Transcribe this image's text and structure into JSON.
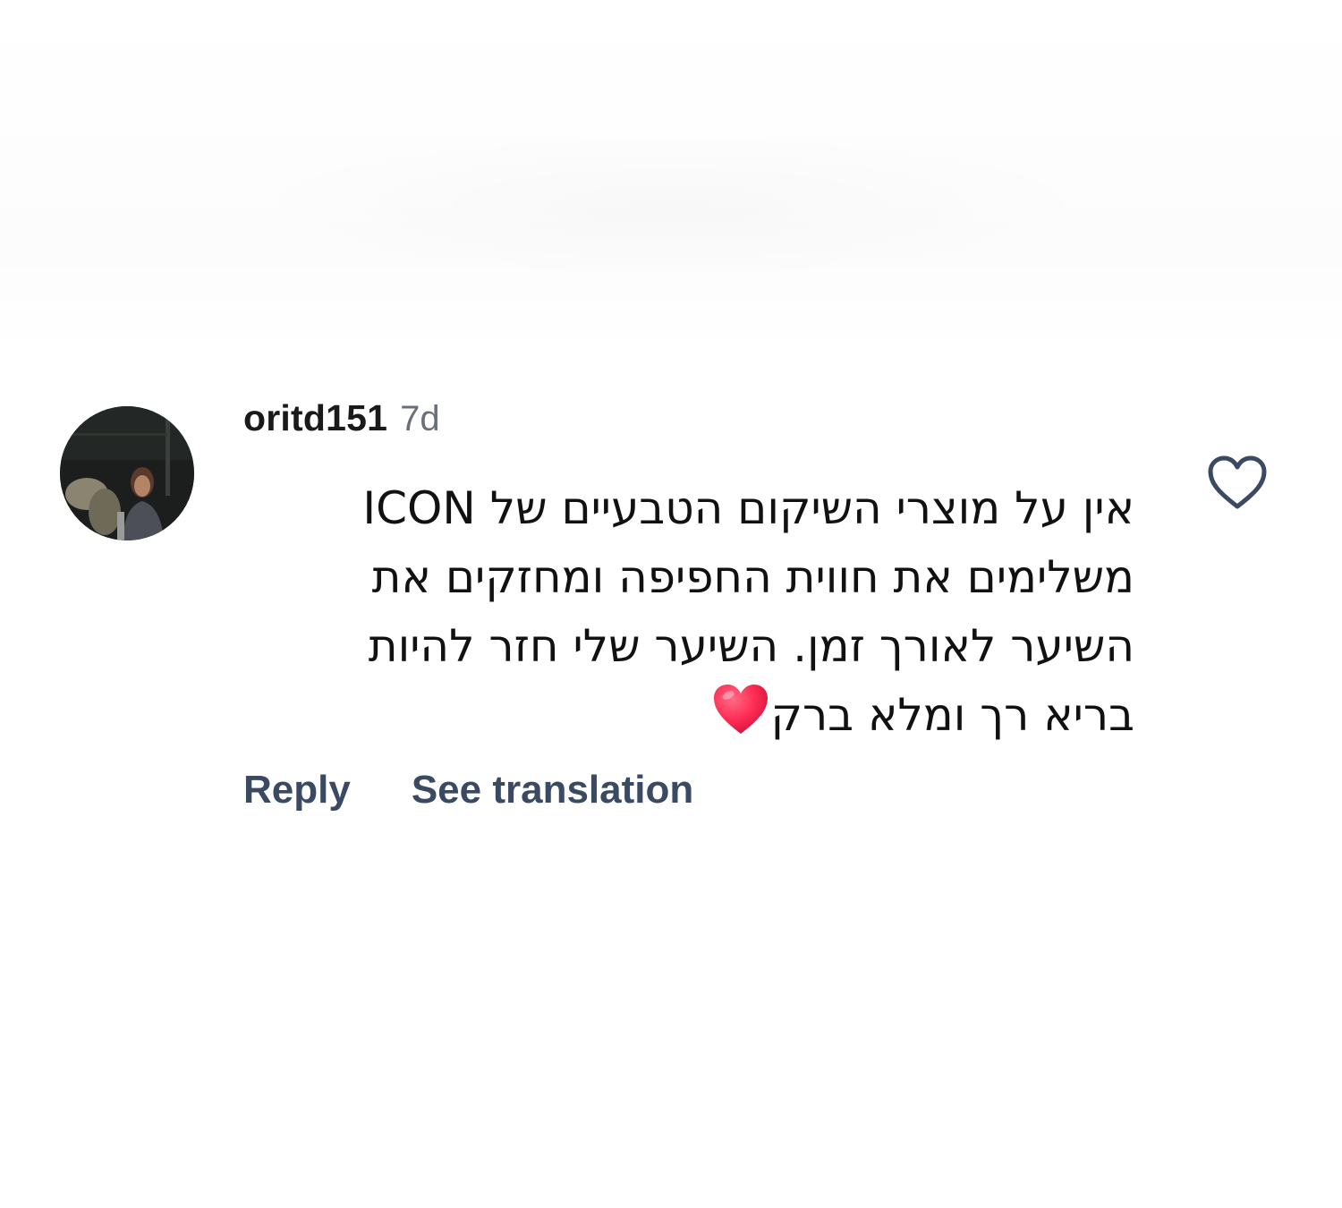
{
  "comment": {
    "username": "oritd151",
    "timestamp": "7d",
    "text_lines": [
      "אין על מוצרי השיקום הטבעיים של ICON",
      "משלימים את חווית החפיפה ומחזקים את",
      "השיער  לאורך זמן. השיער שלי חזר להיות",
      "בריא רך ומלא ברק"
    ],
    "trailing_emoji": "heart-emoji"
  },
  "actions": {
    "reply_label": "Reply",
    "translate_label": "See translation"
  },
  "icons": {
    "like": "heart-outline-icon",
    "avatar": "profile-photo"
  },
  "colors": {
    "username": "#1a1a1a",
    "timestamp": "#6b6f78",
    "action_text": "#3b4a63",
    "heart_emoji": "#ff2d55",
    "like_icon_stroke": "#3b4a63"
  }
}
